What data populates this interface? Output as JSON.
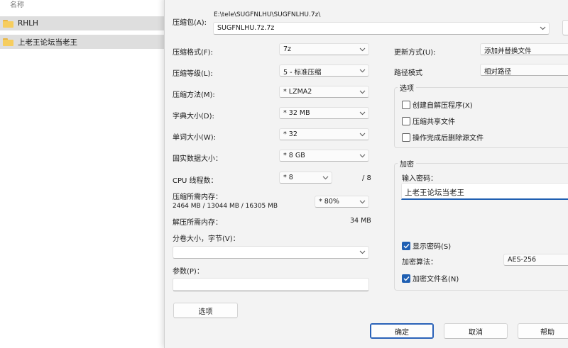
{
  "explorer": {
    "column_header": "名称",
    "folders": [
      "RHLH",
      "上老王论坛当老王"
    ]
  },
  "dialog": {
    "archive_label": "压缩包(A):",
    "archive_path": "E:\\tele\\SUGFNLHU\\SUGFNLHU.7z\\",
    "archive_name": "SUGFNLHU.7z.7z",
    "format_label": "压缩格式(F):",
    "format_value": "7z",
    "level_label": "压缩等级(L):",
    "level_value": "5 - 标准压缩",
    "method_label": "压缩方法(M):",
    "method_value": "* LZMA2",
    "dict_label": "字典大小(D):",
    "dict_value": "* 32 MB",
    "word_label": "单词大小(W):",
    "word_value": "* 32",
    "solid_label": "固实数据大小：",
    "solid_value": "* 8 GB",
    "threads_label": "CPU 线程数：",
    "threads_value": "* 8",
    "threads_max": "/ 8",
    "mem_comp_label": "压缩所需内存：",
    "mem_comp_detail": "2464 MB / 13044 MB / 16305 MB",
    "mem_comp_value": "* 80%",
    "mem_decomp_label": "解压所需内存：",
    "mem_decomp_value": "34 MB",
    "volume_label": "分卷大小，字节(V)：",
    "volume_value": "",
    "params_label": "参数(P)：",
    "params_value": "",
    "options_button": "选项",
    "update_label": "更新方式(U):",
    "update_value": "添加并替换文件",
    "pathmode_label": "路径模式",
    "pathmode_value": "相对路径",
    "options_group": "选项",
    "opt_sfx": "创建自解压程序(X)",
    "opt_shared": "压缩共享文件",
    "opt_delete": "操作完成后删除源文件",
    "encrypt_group": "加密",
    "password_label": "输入密码：",
    "password_value": "上老王论坛当老王",
    "show_password": "显示密码(S)",
    "enc_method_label": "加密算法：",
    "enc_method_value": "AES-256",
    "encrypt_names": "加密文件名(N)",
    "ok_button": "确定",
    "cancel_button": "取消",
    "help_button": "帮助"
  },
  "colors": {
    "accent": "#1f5fb2",
    "dialog_bg": "#f3f3f3",
    "row_selected": "#dedede"
  }
}
